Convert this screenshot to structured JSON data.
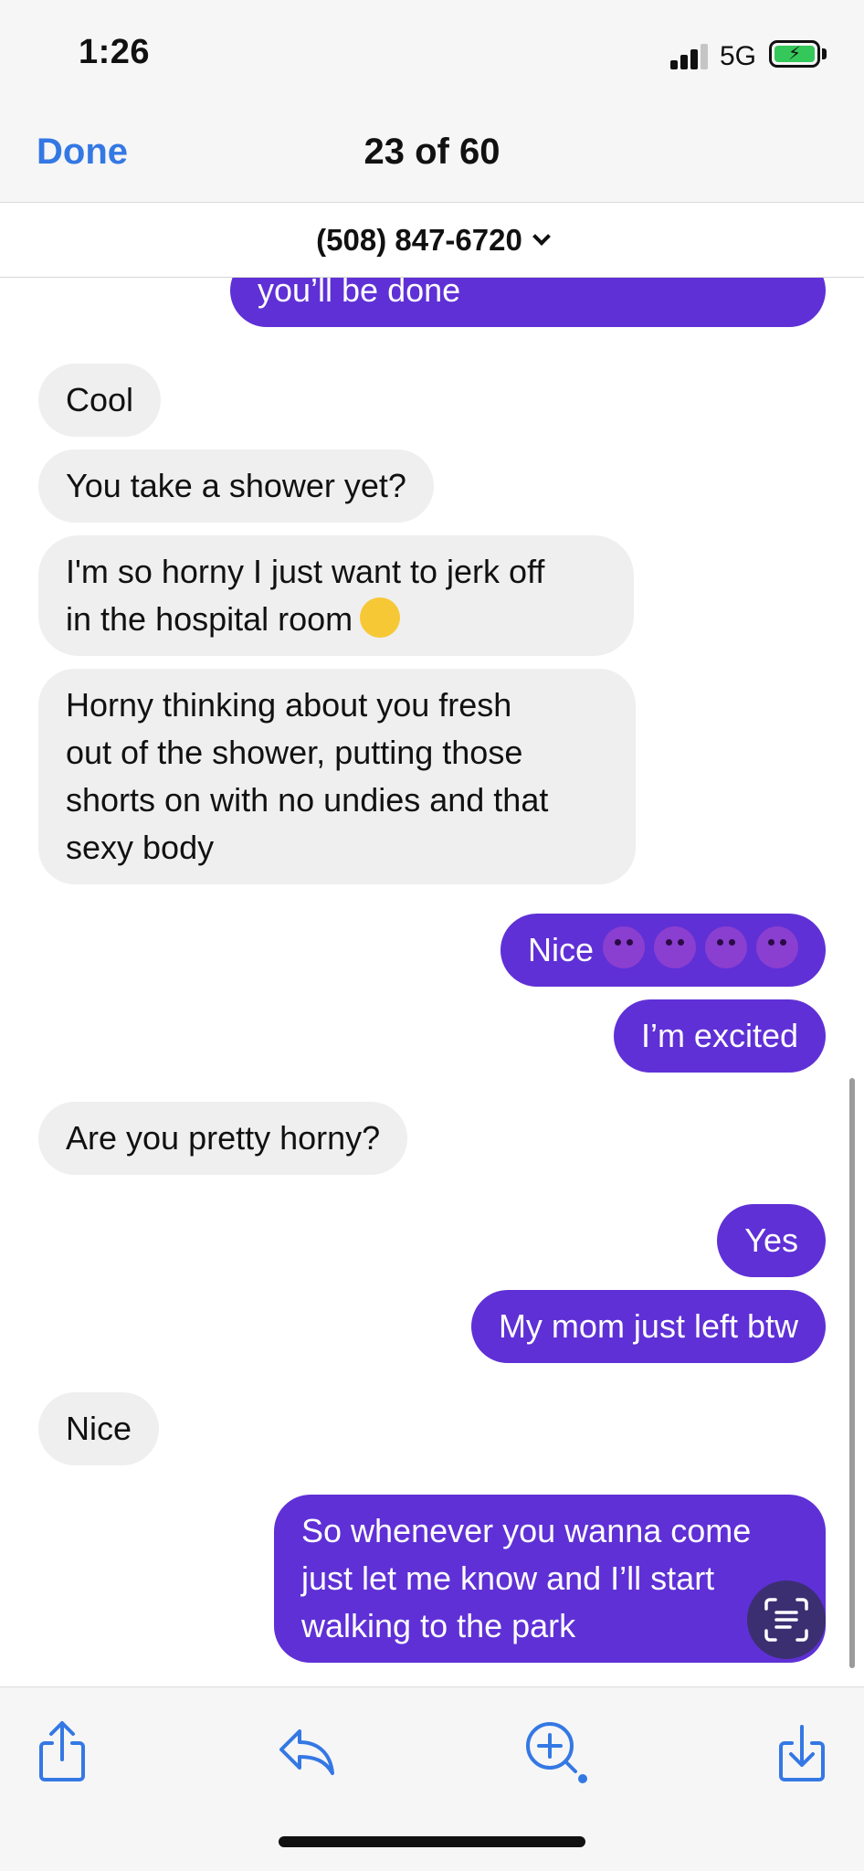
{
  "status_bar": {
    "time": "1:26",
    "network": "5G",
    "icons": [
      "signal-icon",
      "battery-charging-icon"
    ]
  },
  "header": {
    "done_label": "Done",
    "counter": "23 of 60"
  },
  "contact": {
    "number": "(508) 847-6720"
  },
  "messages": [
    {
      "from": "me",
      "text": "you’ll be done"
    },
    {
      "from": "them",
      "text": "Cool"
    },
    {
      "from": "them",
      "text": "You take a shower yet?"
    },
    {
      "from": "them",
      "lines": [
        "I'm so horny I just want to jerk off",
        "in the hospital room"
      ],
      "emoji": "smirking-face"
    },
    {
      "from": "them",
      "lines": [
        "Horny thinking about you fresh",
        "out of the shower, putting those",
        "shorts on with no undies and that",
        "sexy body"
      ]
    },
    {
      "from": "me",
      "text": "Nice",
      "emoji": "smiling-devil x4"
    },
    {
      "from": "me",
      "text": "I’m excited"
    },
    {
      "from": "them",
      "text": "Are you pretty horny?"
    },
    {
      "from": "me",
      "text": "Yes"
    },
    {
      "from": "me",
      "text": "My mom just left btw"
    },
    {
      "from": "them",
      "text": "Nice"
    },
    {
      "from": "me",
      "lines": [
        "So whenever you wanna come",
        "just let me know and I’ll start",
        "walking to the park"
      ]
    }
  ],
  "colors": {
    "outgoing_bubble": "#5f30d6",
    "incoming_bubble": "#efefef",
    "accent": "#3478e4"
  },
  "toolbar": {
    "icons": [
      "share-icon",
      "reply-icon",
      "visual-lookup-icon",
      "save-icon"
    ]
  }
}
